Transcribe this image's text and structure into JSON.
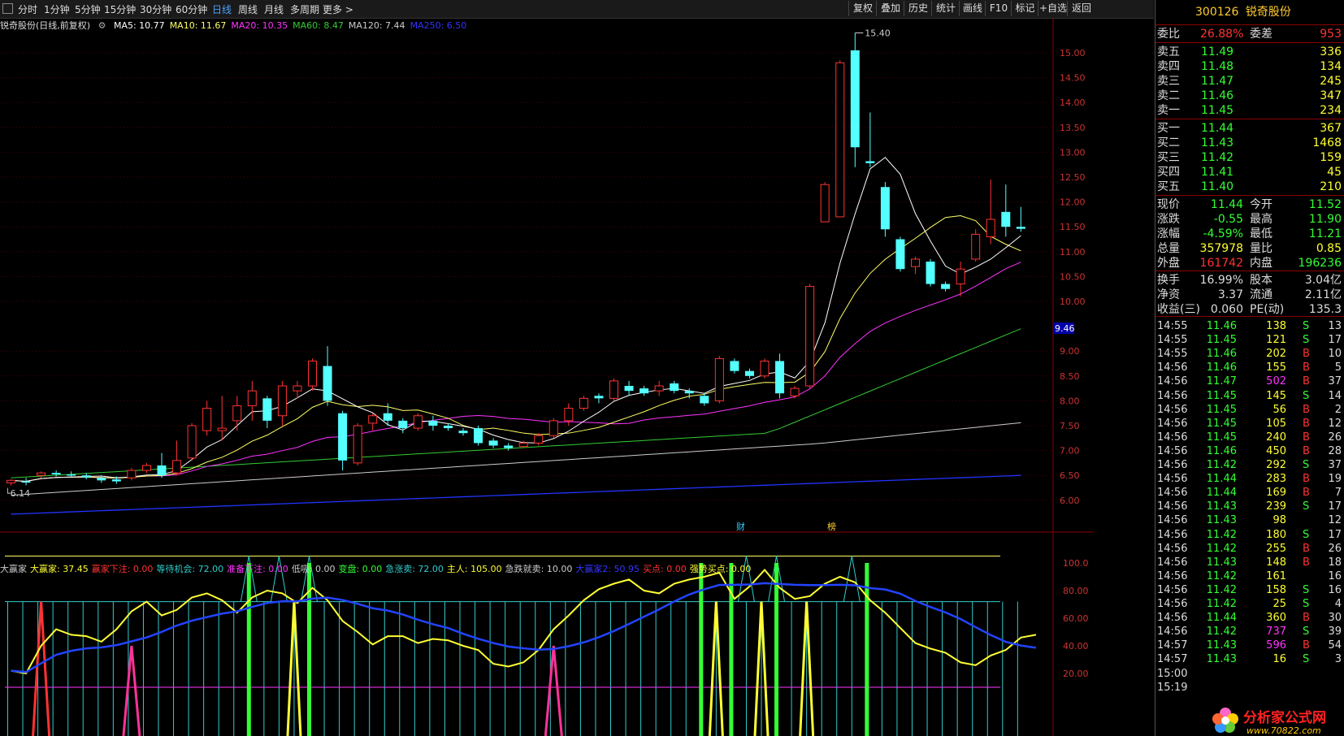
{
  "toolbar": {
    "left": [
      "分时",
      "1分钟",
      "5分钟",
      "15分钟",
      "30分钟",
      "60分钟",
      "日线",
      "周线",
      "月线",
      "多周期",
      "更多 >"
    ],
    "active": "日线",
    "right": [
      "复权",
      "叠加",
      "历史",
      "统计",
      "画线",
      "F10",
      "标记",
      "+自选",
      "返回"
    ]
  },
  "title_line": {
    "name": "锐奇股份(日线,前复权)",
    "ma": [
      {
        "label": "MA5: 10.77",
        "color": "#ffffff"
      },
      {
        "label": "MA10: 11.67",
        "color": "#ffff66"
      },
      {
        "label": "MA20: 10.35",
        "color": "#ff33ff"
      },
      {
        "label": "MA60: 8.47",
        "color": "#33cc33"
      },
      {
        "label": "MA120: 7.44",
        "color": "#cccccc"
      },
      {
        "label": "MA250: 6.50",
        "color": "#3333ff"
      }
    ]
  },
  "indicator_line": {
    "items": [
      {
        "label": "大赢家",
        "color": "#cccccc"
      },
      {
        "label": "大赢家: 37.45",
        "color": "#ffff33"
      },
      {
        "label": "赢家下注: 0.00",
        "color": "#ff3333"
      },
      {
        "label": "等待机会: 72.00",
        "color": "#33cccc"
      },
      {
        "label": "准备下注: 0.00",
        "color": "#ff33ff"
      },
      {
        "label": "低吸: 0.00",
        "color": "#cccccc"
      },
      {
        "label": "变盘: 0.00",
        "color": "#33ff33"
      },
      {
        "label": "急涨卖: 72.00",
        "color": "#33cccc"
      },
      {
        "label": "主人: 105.00",
        "color": "#ffff33"
      },
      {
        "label": "急跌就卖: 10.00",
        "color": "#cccccc"
      },
      {
        "label": "大赢家2: 50.95",
        "color": "#3333ff"
      },
      {
        "label": "买点: 0.00",
        "color": "#ff3333"
      },
      {
        "label": "强势买点: 0.00",
        "color": "#ffff33"
      }
    ]
  },
  "price_axis": [
    "15.00",
    "14.50",
    "14.00",
    "13.50",
    "13.00",
    "12.50",
    "12.00",
    "11.50",
    "11.00",
    "10.50",
    "10.00",
    "9.00",
    "8.50",
    "8.00",
    "7.50",
    "7.00",
    "6.50",
    "6.00"
  ],
  "price_tag": "9.46",
  "hi_label": "15.40",
  "lo_label": "6.14",
  "markers": [
    "财",
    "榜"
  ],
  "ind_axis": [
    "100.0",
    "80.00",
    "60.00",
    "40.00",
    "20.00"
  ],
  "chart_data": {
    "type": "candlestick",
    "candles": [
      [
        6.35,
        6.4,
        6.3,
        6.42
      ],
      [
        6.38,
        6.36,
        6.3,
        6.45
      ],
      [
        6.5,
        6.55,
        6.45,
        6.58
      ],
      [
        6.55,
        6.52,
        6.48,
        6.6
      ],
      [
        6.52,
        6.5,
        6.45,
        6.58
      ],
      [
        6.5,
        6.46,
        6.42,
        6.55
      ],
      [
        6.45,
        6.4,
        6.35,
        6.5
      ],
      [
        6.42,
        6.38,
        6.33,
        6.48
      ],
      [
        6.45,
        6.6,
        6.4,
        6.65
      ],
      [
        6.6,
        6.7,
        6.55,
        6.75
      ],
      [
        6.7,
        6.5,
        6.45,
        6.95
      ],
      [
        6.55,
        6.8,
        6.5,
        7.2
      ],
      [
        6.85,
        7.5,
        6.8,
        7.55
      ],
      [
        7.4,
        7.85,
        7.3,
        8.0
      ],
      [
        7.4,
        7.45,
        7.2,
        8.1
      ],
      [
        7.6,
        7.9,
        7.4,
        8.1
      ],
      [
        7.9,
        8.2,
        7.6,
        8.4
      ],
      [
        8.05,
        7.6,
        7.45,
        8.1
      ],
      [
        7.7,
        8.3,
        7.5,
        8.4
      ],
      [
        8.2,
        8.3,
        8.05,
        8.4
      ],
      [
        8.3,
        8.8,
        8.2,
        8.85
      ],
      [
        8.7,
        8.0,
        7.9,
        9.1
      ],
      [
        7.75,
        6.8,
        6.6,
        7.8
      ],
      [
        6.75,
        7.5,
        6.7,
        7.55
      ],
      [
        7.55,
        7.7,
        7.4,
        7.75
      ],
      [
        7.75,
        7.6,
        7.5,
        7.95
      ],
      [
        7.6,
        7.45,
        7.35,
        7.65
      ],
      [
        7.45,
        7.7,
        7.4,
        7.75
      ],
      [
        7.6,
        7.5,
        7.4,
        7.7
      ],
      [
        7.5,
        7.45,
        7.4,
        7.55
      ],
      [
        7.4,
        7.35,
        7.3,
        7.45
      ],
      [
        7.45,
        7.15,
        7.1,
        7.5
      ],
      [
        7.2,
        7.1,
        7.05,
        7.25
      ],
      [
        7.1,
        7.05,
        7.0,
        7.15
      ],
      [
        7.08,
        7.15,
        7.05,
        7.2
      ],
      [
        7.15,
        7.3,
        7.1,
        7.35
      ],
      [
        7.3,
        7.6,
        7.25,
        7.65
      ],
      [
        7.6,
        7.85,
        7.5,
        7.95
      ],
      [
        7.85,
        8.05,
        7.8,
        8.1
      ],
      [
        8.1,
        8.05,
        7.95,
        8.15
      ],
      [
        8.05,
        8.4,
        8.0,
        8.45
      ],
      [
        8.3,
        8.2,
        8.1,
        8.4
      ],
      [
        8.25,
        8.15,
        8.1,
        8.3
      ],
      [
        8.2,
        8.3,
        8.1,
        8.4
      ],
      [
        8.35,
        8.2,
        8.15,
        8.4
      ],
      [
        8.2,
        8.15,
        8.05,
        8.25
      ],
      [
        8.1,
        7.95,
        7.9,
        8.15
      ],
      [
        8.0,
        8.85,
        7.95,
        8.9
      ],
      [
        8.8,
        8.6,
        8.55,
        8.85
      ],
      [
        8.6,
        8.5,
        8.45,
        8.65
      ],
      [
        8.5,
        8.8,
        8.45,
        8.85
      ],
      [
        8.8,
        8.15,
        8.05,
        8.95
      ],
      [
        8.1,
        8.25,
        8.05,
        8.3
      ],
      [
        8.3,
        10.3,
        8.25,
        10.35
      ],
      [
        11.6,
        12.35,
        11.6,
        12.4
      ],
      [
        11.7,
        14.8,
        11.7,
        14.85
      ],
      [
        15.05,
        13.1,
        12.7,
        15.4
      ],
      [
        12.82,
        12.78,
        12.7,
        13.8
      ],
      [
        12.3,
        11.45,
        11.3,
        12.4
      ],
      [
        11.25,
        10.65,
        10.6,
        11.3
      ],
      [
        10.7,
        10.85,
        10.55,
        10.9
      ],
      [
        10.8,
        10.35,
        10.3,
        10.85
      ],
      [
        10.35,
        10.25,
        10.2,
        10.4
      ],
      [
        10.35,
        10.65,
        10.1,
        10.8
      ],
      [
        10.85,
        11.35,
        10.8,
        11.45
      ],
      [
        11.3,
        11.65,
        11.15,
        12.45
      ],
      [
        11.8,
        11.5,
        11.3,
        12.35
      ],
      [
        11.5,
        11.46,
        11.4,
        11.9
      ]
    ],
    "ma_values": {
      "MA5": 10.77,
      "MA10": 11.67,
      "MA20": 10.35,
      "MA60": 8.47,
      "MA120": 7.44,
      "MA250": 6.5
    },
    "indicator": {
      "yellow": [
        22,
        20,
        40,
        52,
        48,
        47,
        43,
        52,
        65,
        72,
        62,
        66,
        75,
        78,
        73,
        64,
        75,
        80,
        78,
        71,
        82,
        73,
        58,
        50,
        41,
        47,
        47,
        42,
        45,
        44,
        40,
        37,
        27,
        25,
        28,
        37,
        52,
        62,
        73,
        81,
        85,
        88,
        80,
        78,
        85,
        88,
        90,
        93,
        74,
        83,
        95,
        82,
        74,
        76,
        85,
        90,
        86,
        73,
        64,
        53,
        42,
        38,
        35,
        28,
        26,
        33,
        37,
        46,
        48
      ]
    }
  },
  "quote": {
    "code": "300126",
    "name": "锐奇股份",
    "weibi_label": "委比",
    "weibi": "26.88%",
    "weicha_label": "委差",
    "weicha": "953",
    "asks": [
      [
        "卖五",
        "11.49",
        "336"
      ],
      [
        "卖四",
        "11.48",
        "134"
      ],
      [
        "卖三",
        "11.47",
        "245"
      ],
      [
        "卖二",
        "11.46",
        "347"
      ],
      [
        "卖一",
        "11.45",
        "234"
      ]
    ],
    "bids": [
      [
        "买一",
        "11.44",
        "367"
      ],
      [
        "买二",
        "11.43",
        "1468"
      ],
      [
        "买三",
        "11.42",
        "159"
      ],
      [
        "买四",
        "11.41",
        "45"
      ],
      [
        "买五",
        "11.40",
        "210"
      ]
    ],
    "stats": [
      [
        [
          "现价",
          "11.44",
          "#33ff33"
        ],
        [
          "今开",
          "11.52",
          "#33ff33"
        ]
      ],
      [
        [
          "涨跌",
          "-0.55",
          "#33ff33"
        ],
        [
          "最高",
          "11.90",
          "#33ff33"
        ]
      ],
      [
        [
          "涨幅",
          "-4.59%",
          "#33ff33"
        ],
        [
          "最低",
          "11.21",
          "#33ff33"
        ]
      ],
      [
        [
          "总量",
          "357978",
          "#ffff33"
        ],
        [
          "量比",
          "0.85",
          "#ffff33"
        ]
      ],
      [
        [
          "外盘",
          "161742",
          "#ff3333"
        ],
        [
          "内盘",
          "196236",
          "#33ff33"
        ]
      ]
    ],
    "stats2": [
      [
        [
          "换手",
          "16.99%"
        ],
        [
          "股本",
          "3.04亿"
        ]
      ],
      [
        [
          "净资",
          "3.37"
        ],
        [
          "流通",
          "2.11亿"
        ]
      ],
      [
        [
          "收益(三)",
          "0.060"
        ],
        [
          "PE(动)",
          "135.3"
        ]
      ]
    ],
    "ticks": [
      [
        "14:55",
        "11.46",
        "138",
        "S",
        "13"
      ],
      [
        "14:55",
        "11.45",
        "121",
        "S",
        "17"
      ],
      [
        "14:55",
        "11.46",
        "202",
        "B",
        "10"
      ],
      [
        "14:56",
        "11.46",
        "155",
        "B",
        "5"
      ],
      [
        "14:56",
        "11.47",
        "502",
        "B",
        "37"
      ],
      [
        "14:56",
        "11.45",
        "145",
        "S",
        "14"
      ],
      [
        "14:56",
        "11.45",
        "56",
        "B",
        "2"
      ],
      [
        "14:56",
        "11.45",
        "105",
        "B",
        "12"
      ],
      [
        "14:56",
        "11.45",
        "240",
        "B",
        "26"
      ],
      [
        "14:56",
        "11.46",
        "450",
        "B",
        "28"
      ],
      [
        "14:56",
        "11.42",
        "292",
        "S",
        "37"
      ],
      [
        "14:56",
        "11.44",
        "283",
        "B",
        "19"
      ],
      [
        "14:56",
        "11.44",
        "169",
        "B",
        "7"
      ],
      [
        "14:56",
        "11.43",
        "239",
        "S",
        "17"
      ],
      [
        "14:56",
        "11.43",
        "98",
        "",
        "12"
      ],
      [
        "14:56",
        "11.42",
        "180",
        "S",
        "17"
      ],
      [
        "14:56",
        "11.42",
        "255",
        "B",
        "26"
      ],
      [
        "14:56",
        "11.43",
        "148",
        "B",
        "18"
      ],
      [
        "14:56",
        "11.42",
        "161",
        "",
        "16"
      ],
      [
        "14:56",
        "11.42",
        "158",
        "S",
        "16"
      ],
      [
        "14:56",
        "11.42",
        "25",
        "S",
        "4"
      ],
      [
        "14:56",
        "11.44",
        "360",
        "B",
        "30"
      ],
      [
        "14:56",
        "11.42",
        "737",
        "S",
        "39"
      ],
      [
        "14:57",
        "11.43",
        "596",
        "B",
        "54"
      ],
      [
        "14:57",
        "11.43",
        "16",
        "S",
        "3"
      ],
      [
        "15:00",
        "",
        "",
        "",
        ""
      ],
      [
        "15:19",
        "",
        "",
        "",
        ""
      ]
    ]
  },
  "watermark": {
    "site": "分析家公式网",
    "url": "www.70822.com"
  }
}
